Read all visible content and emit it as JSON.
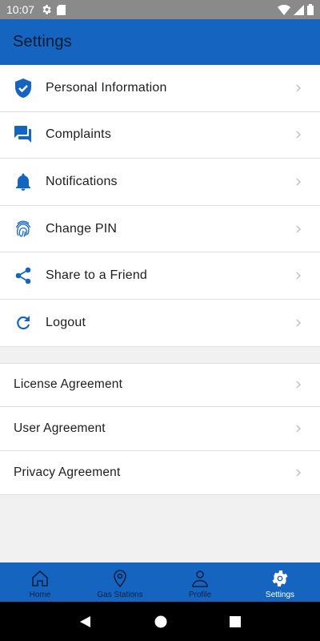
{
  "status_bar": {
    "time": "10:07"
  },
  "app_bar": {
    "title": "Settings"
  },
  "menu_items": [
    {
      "label": "Personal Information",
      "icon": "shield-check-icon"
    },
    {
      "label": "Complaints",
      "icon": "chat-icon"
    },
    {
      "label": "Notifications",
      "icon": "bell-icon"
    },
    {
      "label": "Change PIN",
      "icon": "fingerprint-icon"
    },
    {
      "label": "Share to a Friend",
      "icon": "share-icon"
    },
    {
      "label": "Logout",
      "icon": "refresh-icon"
    }
  ],
  "agreements": [
    {
      "label": "License Agreement"
    },
    {
      "label": "User Agreement"
    },
    {
      "label": "Privacy Agreement"
    }
  ],
  "bottom_nav": {
    "tabs": [
      {
        "label": "Home",
        "icon": "home-icon"
      },
      {
        "label": "Gas Stations",
        "icon": "location-pin-icon"
      },
      {
        "label": "Profile",
        "icon": "person-icon"
      },
      {
        "label": "Settings",
        "icon": "gear-icon"
      }
    ],
    "active": "Settings"
  },
  "colors": {
    "primary": "#1565c0",
    "icon": "#1565c0",
    "background": "#f1f1f1"
  }
}
